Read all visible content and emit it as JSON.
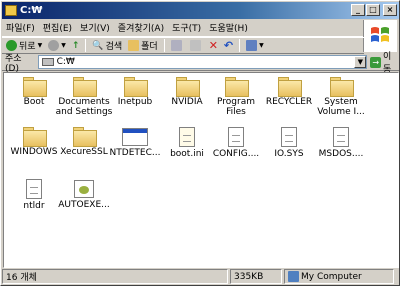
{
  "window": {
    "title": "C:₩"
  },
  "menu": [
    "파일(F)",
    "편집(E)",
    "보기(V)",
    "즐겨찾기(A)",
    "도구(T)",
    "도움말(H)"
  ],
  "toolbar": {
    "back": "뒤로",
    "search": "검색",
    "folders": "폴더"
  },
  "address": {
    "label": "주소(D)",
    "value": "C:₩",
    "go": "이동"
  },
  "items": [
    {
      "name": "Boot",
      "type": "folder"
    },
    {
      "name": "Documents and Settings",
      "type": "folder"
    },
    {
      "name": "Inetpub",
      "type": "folder"
    },
    {
      "name": "NVIDIA",
      "type": "folder"
    },
    {
      "name": "Program Files",
      "type": "folder"
    },
    {
      "name": "RECYCLER",
      "type": "folder"
    },
    {
      "name": "System Volume I...",
      "type": "folder"
    },
    {
      "name": "WINDOWS",
      "type": "folder"
    },
    {
      "name": "XecureSSL",
      "type": "folder"
    },
    {
      "name": "NTDETEC...",
      "type": "exe"
    },
    {
      "name": "boot.ini",
      "type": "ini"
    },
    {
      "name": "CONFIG....",
      "type": "file"
    },
    {
      "name": "IO.SYS",
      "type": "file"
    },
    {
      "name": "MSDOS....",
      "type": "file"
    },
    {
      "name": "ntldr",
      "type": "file"
    },
    {
      "name": "AUTOEXE...",
      "type": "bat"
    }
  ],
  "status": {
    "count": "16 개체",
    "size": "335KB",
    "location": "My Computer"
  },
  "colors": {
    "titlebar": "#0a246a",
    "face": "#d4d0c8"
  }
}
